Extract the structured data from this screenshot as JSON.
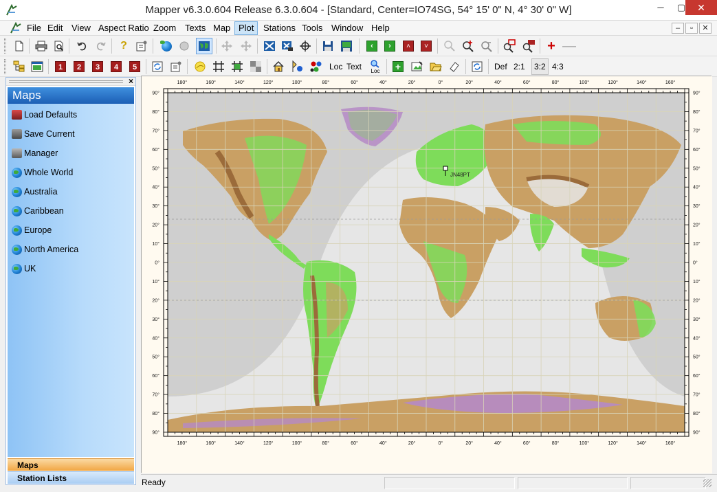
{
  "window": {
    "title": "Mapper v6.3.0.604 Release 6.3.0.604 - [Standard, Center=IO74SG, 54° 15' 0\" N, 4° 30' 0\" W]",
    "app_icon": "mapper-logo-icon",
    "min_label": "─",
    "max_label": "▢",
    "close_label": "✕"
  },
  "menu": {
    "items": [
      "File",
      "Edit",
      "View",
      "Aspect Ratio",
      "Zoom",
      "Texts",
      "Map",
      "Plot",
      "Stations",
      "Tools",
      "Window",
      "Help"
    ],
    "active": "Plot",
    "mdi_min": "–",
    "mdi_restore": "▫",
    "mdi_close": "✕"
  },
  "toolbar2": {
    "presets": [
      "1",
      "2",
      "3",
      "4",
      "5"
    ],
    "loc_label": "Loc",
    "text_label": "Text",
    "loc_small": "Loc",
    "def_label": "Def",
    "ratio_21": "2:1",
    "ratio_32": "3:2",
    "ratio_43": "4:3"
  },
  "panel": {
    "header": "Maps",
    "items": [
      {
        "label": "Load Defaults",
        "icon": "load-defaults-icon"
      },
      {
        "label": "Save Current",
        "icon": "save-current-icon"
      },
      {
        "label": "Manager",
        "icon": "manager-icon"
      },
      {
        "label": "Whole World",
        "icon": "globe-icon"
      },
      {
        "label": "Australia",
        "icon": "globe-icon"
      },
      {
        "label": "Caribbean",
        "icon": "globe-icon"
      },
      {
        "label": "Europe",
        "icon": "globe-icon"
      },
      {
        "label": "North America",
        "icon": "globe-icon"
      },
      {
        "label": "UK",
        "icon": "globe-icon"
      }
    ],
    "tab_maps": "Maps",
    "tab_stations": "Station Lists",
    "close_label": "×"
  },
  "map": {
    "lon_labels": [
      "180°",
      "160°",
      "140°",
      "120°",
      "100°",
      "80°",
      "60°",
      "40°",
      "20°",
      "0°",
      "20°",
      "40°",
      "60°",
      "80°",
      "100°",
      "120°",
      "140°",
      "160°"
    ],
    "lat_labels": [
      "90°",
      "80°",
      "70°",
      "60°",
      "50°",
      "40°",
      "30°",
      "20°",
      "10°",
      "0°",
      "10°",
      "20°",
      "30°",
      "40°",
      "50°",
      "60°",
      "70°",
      "80°",
      "90°"
    ],
    "station_label": "JN48PT",
    "colors": {
      "background": "#fffaf0",
      "night": "#cfcfcf",
      "day": "#e6e6e6",
      "lowland": "#7edc5a",
      "upland": "#c9a064",
      "highland": "#9b6b3a",
      "ice": "#b58ac5"
    }
  },
  "status": {
    "text": "Ready"
  }
}
